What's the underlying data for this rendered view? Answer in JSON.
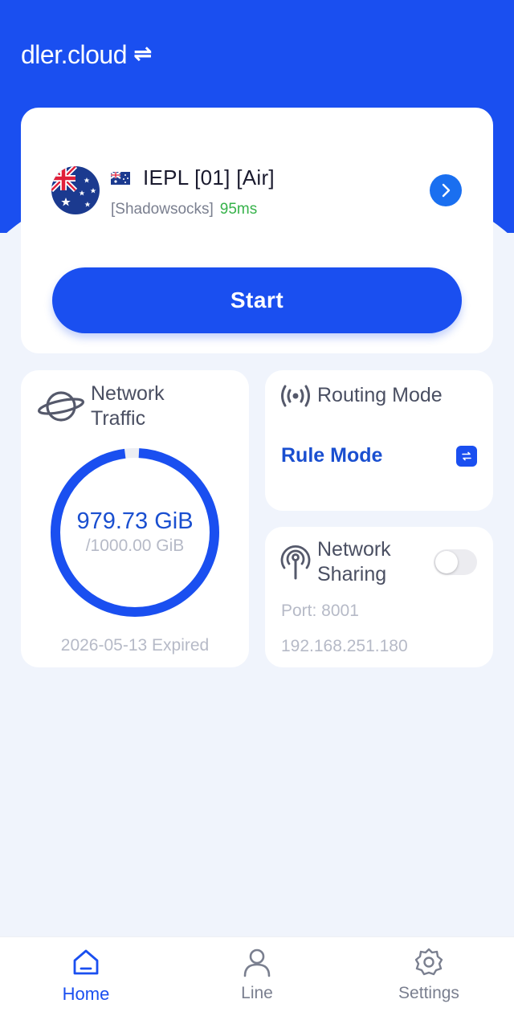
{
  "app": {
    "brand": "dler.cloud",
    "switch_icon": "swap-arrows-icon",
    "accent_color": "#1a4ff0"
  },
  "server": {
    "flag_icon": "australia-flag-icon",
    "name": "IEPL [01] [Air]",
    "protocol": "[Shadowsocks]",
    "latency": "95ms",
    "latency_color": "#36b24a",
    "detail_icon": "chevron-right-icon"
  },
  "start_button": {
    "label": "Start"
  },
  "traffic": {
    "icon": "planet-icon",
    "title": "Network Traffic",
    "used": "979.73 GiB",
    "total": "/1000.00 GiB",
    "used_fraction": 0.97973,
    "expiry": "2026-05-13 Expired"
  },
  "routing": {
    "icon": "broadcast-icon",
    "title": "Routing Mode",
    "mode": "Rule Mode",
    "switch_icon": "swap-icon"
  },
  "sharing": {
    "icon": "antenna-icon",
    "title": "Network Sharing",
    "enabled": false,
    "port": "Port: 8001",
    "ip": "192.168.251.180"
  },
  "tabs": [
    {
      "label": "Home",
      "icon": "home-icon",
      "active": true
    },
    {
      "label": "Line",
      "icon": "user-icon",
      "active": false
    },
    {
      "label": "Settings",
      "icon": "gear-icon",
      "active": false
    }
  ]
}
